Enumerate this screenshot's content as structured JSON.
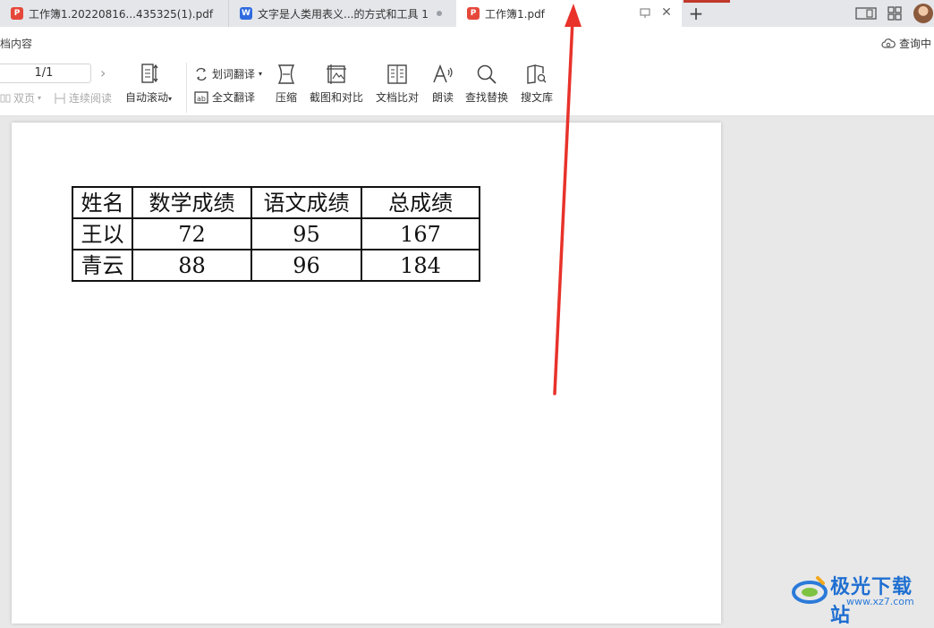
{
  "tabs": [
    {
      "label": "工作簿1.20220816...435325(1).pdf",
      "type": "pdf",
      "active": false
    },
    {
      "label": "文字是人类用表义...的方式和工具 1",
      "type": "word",
      "active": false
    },
    {
      "label": "工作簿1.pdf",
      "type": "pdf",
      "active": true
    }
  ],
  "tab_icons": {
    "pdf": "P",
    "word": "W"
  },
  "new_tab_label": "+",
  "toolbar": {
    "doc_content_label": "档内容",
    "query_label": "查询中",
    "page_indicator": "1/1",
    "double_page_label": "双页",
    "continuous_read_label": "连续阅读",
    "auto_scroll_label": "自动滚动",
    "word_translate_label": "划词翻译",
    "full_translate_label": "全文翻译",
    "compress_label": "压缩",
    "screenshot_compare_label": "截图和对比",
    "doc_compare_label": "文档比对",
    "read_aloud_label": "朗读",
    "find_replace_label": "查找替换",
    "search_library_label": "搜文库"
  },
  "table": {
    "headers": [
      "姓名",
      "数学成绩",
      "语文成绩",
      "总成绩"
    ],
    "rows": [
      [
        "王以",
        "72",
        "95",
        "167"
      ],
      [
        "青云",
        "88",
        "96",
        "184"
      ]
    ]
  },
  "watermark": {
    "text": "极光下载站",
    "url": "www.xz7.com"
  },
  "colors": {
    "pdf_icon": "#e5483a",
    "word_icon": "#2f6be0",
    "arrow": "#e8322a",
    "watermark": "#1f6fd1"
  }
}
